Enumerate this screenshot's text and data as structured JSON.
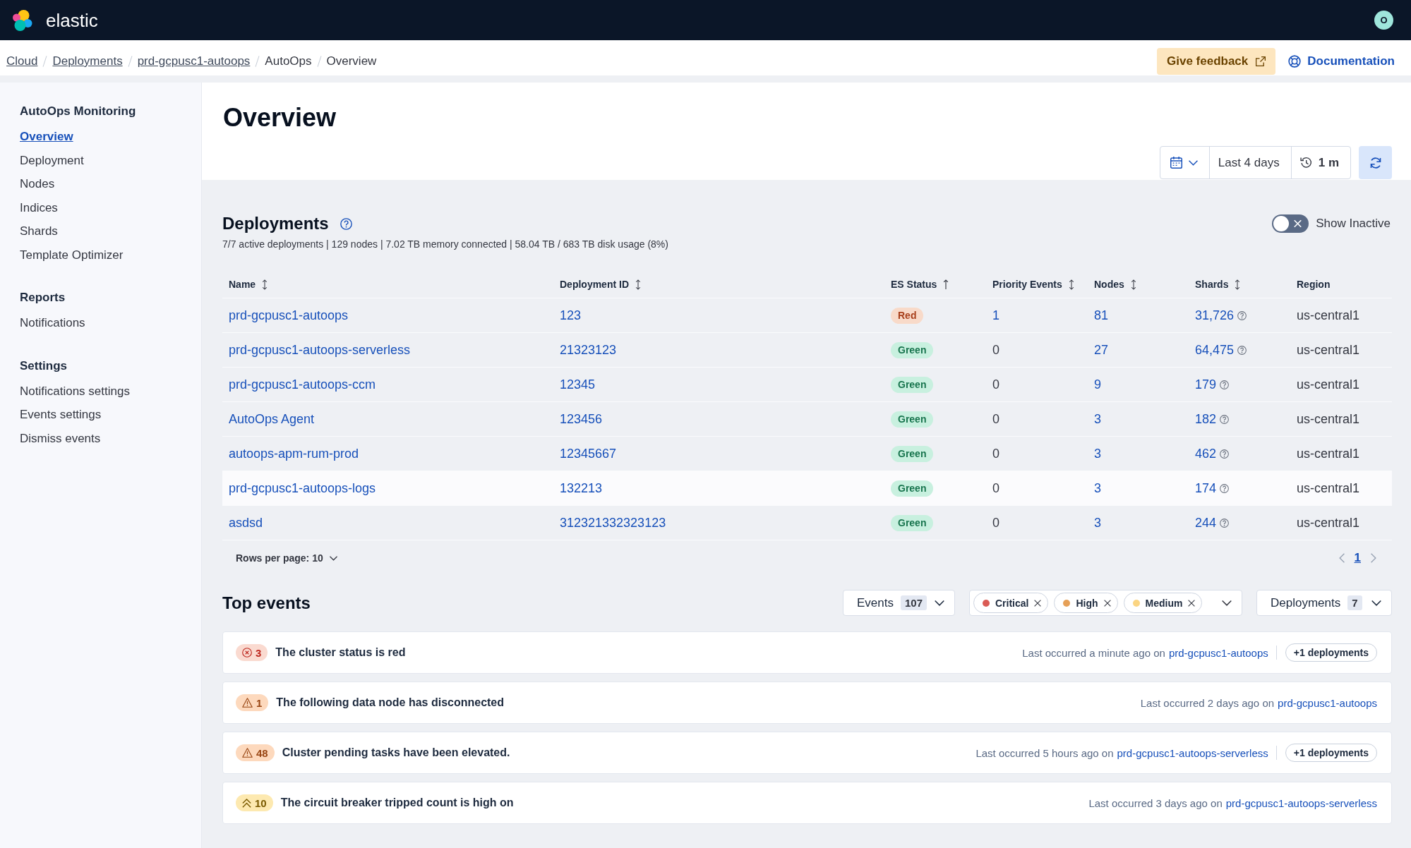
{
  "header": {
    "brand": "elastic",
    "avatar": "O"
  },
  "breadcrumbs": [
    {
      "label": "Cloud",
      "link": true
    },
    {
      "label": "Deployments",
      "link": true
    },
    {
      "label": "prd-gcpusc1-autoops",
      "link": true
    },
    {
      "label": "AutoOps",
      "link": false
    },
    {
      "label": "Overview",
      "link": false
    }
  ],
  "actions": {
    "feedback": "Give feedback",
    "documentation": "Documentation"
  },
  "sidebar": {
    "groups": [
      {
        "title": "AutoOps Monitoring",
        "items": [
          {
            "label": "Overview",
            "selected": true
          },
          {
            "label": "Deployment",
            "selected": false
          },
          {
            "label": "Nodes",
            "selected": false
          },
          {
            "label": "Indices",
            "selected": false
          },
          {
            "label": "Shards",
            "selected": false
          },
          {
            "label": "Template Optimizer",
            "selected": false
          }
        ]
      },
      {
        "title": "Reports",
        "items": [
          {
            "label": "Notifications",
            "selected": false
          }
        ]
      },
      {
        "title": "Settings",
        "items": [
          {
            "label": "Notifications settings",
            "selected": false
          },
          {
            "label": "Events settings",
            "selected": false
          },
          {
            "label": "Dismiss events",
            "selected": false
          }
        ]
      }
    ]
  },
  "page": {
    "title": "Overview",
    "date_picker": {
      "range": "Last 4 days",
      "interval": "1 m"
    }
  },
  "deployments": {
    "title": "Deployments",
    "summary": "7/7 active deployments | 129 nodes | 7.02 TB memory connected | 58.04 TB / 683 TB disk usage (8%)",
    "show_inactive": {
      "label": "Show Inactive",
      "on": false
    },
    "columns": [
      {
        "label": "Name",
        "sortable": true,
        "sorted": false
      },
      {
        "label": "Deployment ID",
        "sortable": true,
        "sorted": false
      },
      {
        "label": "ES Status",
        "sortable": true,
        "sorted": true
      },
      {
        "label": "Priority Events",
        "sortable": true,
        "sorted": false
      },
      {
        "label": "Nodes",
        "sortable": true,
        "sorted": false
      },
      {
        "label": "Shards",
        "sortable": true,
        "sorted": false
      },
      {
        "label": "Region",
        "sortable": false,
        "sorted": false
      }
    ],
    "rows": [
      {
        "name": "prd-gcpusc1-autoops",
        "deployment_id": "123",
        "status": {
          "label": "Red",
          "kind": "red"
        },
        "priority_events": "1",
        "priority_link": true,
        "nodes": "81",
        "shards": "31,726",
        "region": "us-central1",
        "highlighted": false
      },
      {
        "name": "prd-gcpusc1-autoops-serverless",
        "deployment_id": "21323123",
        "status": {
          "label": "Green",
          "kind": "green"
        },
        "priority_events": "0",
        "priority_link": false,
        "nodes": "27",
        "shards": "64,475",
        "region": "us-central1",
        "highlighted": false
      },
      {
        "name": "prd-gcpusc1-autoops-ccm",
        "deployment_id": "12345",
        "status": {
          "label": "Green",
          "kind": "green"
        },
        "priority_events": "0",
        "priority_link": false,
        "nodes": "9",
        "shards": "179",
        "region": "us-central1",
        "highlighted": false
      },
      {
        "name": "AutoOps Agent",
        "deployment_id": "123456",
        "status": {
          "label": "Green",
          "kind": "green"
        },
        "priority_events": "0",
        "priority_link": false,
        "nodes": "3",
        "shards": "182",
        "region": "us-central1",
        "highlighted": false
      },
      {
        "name": "autoops-apm-rum-prod",
        "deployment_id": "12345667",
        "status": {
          "label": "Green",
          "kind": "green"
        },
        "priority_events": "0",
        "priority_link": false,
        "nodes": "3",
        "shards": "462",
        "region": "us-central1",
        "highlighted": false
      },
      {
        "name": "prd-gcpusc1-autoops-logs",
        "deployment_id": "132213",
        "status": {
          "label": "Green",
          "kind": "green"
        },
        "priority_events": "0",
        "priority_link": false,
        "nodes": "3",
        "shards": "174",
        "region": "us-central1",
        "highlighted": true
      },
      {
        "name": "asdsd",
        "deployment_id": "312321332323123",
        "status": {
          "label": "Green",
          "kind": "green"
        },
        "priority_events": "0",
        "priority_link": false,
        "nodes": "3",
        "shards": "244",
        "region": "us-central1",
        "highlighted": false
      }
    ],
    "rows_per_page": "Rows per page: 10",
    "pages": [
      {
        "label": "1",
        "selected": true
      }
    ]
  },
  "top_events": {
    "title": "Top events",
    "filters": {
      "events": {
        "label": "Events",
        "count": "107"
      },
      "severities": [
        {
          "label": "Critical",
          "color": "#da5b55"
        },
        {
          "label": "High",
          "color": "#e6a057"
        },
        {
          "label": "Medium",
          "color": "#fbd582"
        }
      ],
      "deployments": {
        "label": "Deployments",
        "count": "7"
      }
    },
    "events": [
      {
        "kind": "critical",
        "count": "3",
        "title": "The cluster status is red",
        "occurred": "Last occurred a minute ago on",
        "deployment": "prd-gcpusc1-autoops",
        "more": "+1 deployments"
      },
      {
        "kind": "high",
        "count": "1",
        "title": "The following data node has disconnected",
        "occurred": "Last occurred 2 days ago on",
        "deployment": "prd-gcpusc1-autoops"
      },
      {
        "kind": "high",
        "count": "48",
        "title": "Cluster pending tasks have been elevated.",
        "occurred": "Last occurred 5 hours ago on",
        "deployment": "prd-gcpusc1-autoops-serverless",
        "more": "+1 deployments"
      },
      {
        "kind": "medium",
        "count": "10",
        "title": "The circuit breaker tripped count is high on",
        "occurred": "Last occurred 3 days ago on",
        "deployment": "prd-gcpusc1-autoops-serverless"
      }
    ]
  }
}
